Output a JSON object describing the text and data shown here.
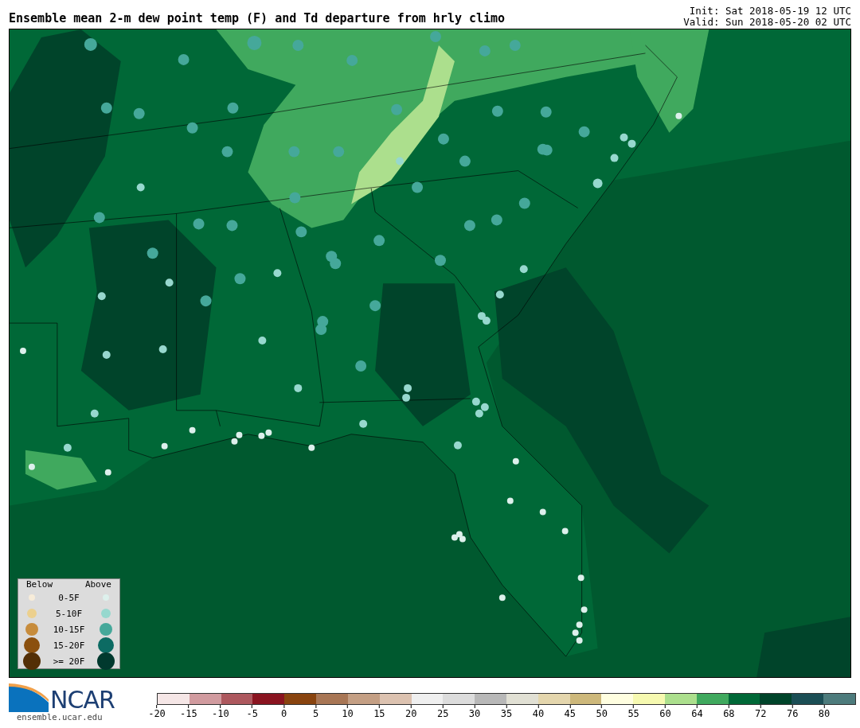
{
  "title": "Ensemble mean 2-m dew point temp (F) and Td departure from hrly climo",
  "init": "Init: Sat 2018-05-19 12 UTC",
  "valid": "Valid: Sun 2018-05-20 02 UTC",
  "legend": {
    "below_heading": "Below",
    "above_heading": "Above",
    "rows": [
      {
        "label": "0-5F",
        "below": {
          "color": "#f7ecd9"
        },
        "above": {
          "color": "#ddf0ec"
        }
      },
      {
        "label": "5-10F",
        "below": {
          "color": "#ecd08e"
        },
        "above": {
          "color": "#97d8ce"
        }
      },
      {
        "label": "10-15F",
        "below": {
          "color": "#c78c3c"
        },
        "above": {
          "color": "#45a89a"
        }
      },
      {
        "label": "15-20F",
        "below": {
          "color": "#8b500e"
        },
        "above": {
          "color": "#0c6b63"
        }
      },
      {
        "label": ">= 20F",
        "below": {
          "color": "#532f06"
        },
        "above": {
          "color": "#01392e"
        }
      }
    ]
  },
  "logo": {
    "text": "NCAR",
    "url": "ensemble.ucar.edu"
  },
  "colorbar": {
    "bins": [
      {
        "color": "#f5e6e6"
      },
      {
        "color": "#d19b9f"
      },
      {
        "color": "#ad585e"
      },
      {
        "color": "#8a1420"
      },
      {
        "color": "#89440f"
      },
      {
        "color": "#a87655"
      },
      {
        "color": "#c49f84"
      },
      {
        "color": "#dcc2b0"
      },
      {
        "color": "#efefef"
      },
      {
        "color": "#dcdcdc"
      },
      {
        "color": "#b8b8b8"
      },
      {
        "color": "#e1e0d4"
      },
      {
        "color": "#e4d6ad"
      },
      {
        "color": "#cdb87b"
      },
      {
        "color": "#fffee0"
      },
      {
        "color": "#f6f9b0"
      },
      {
        "color": "#acdf8d"
      },
      {
        "color": "#40a95e"
      },
      {
        "color": "#006837"
      },
      {
        "color": "#00442a"
      },
      {
        "color": "#1b4e55"
      },
      {
        "color": "#4d7b7c"
      }
    ],
    "ticks": [
      "-20",
      "-15",
      "-10",
      "-5",
      "0",
      "5",
      "10",
      "15",
      "20",
      "25",
      "30",
      "35",
      "40",
      "45",
      "50",
      "55",
      "60",
      "64",
      "68",
      "72",
      "76",
      "80"
    ]
  }
}
